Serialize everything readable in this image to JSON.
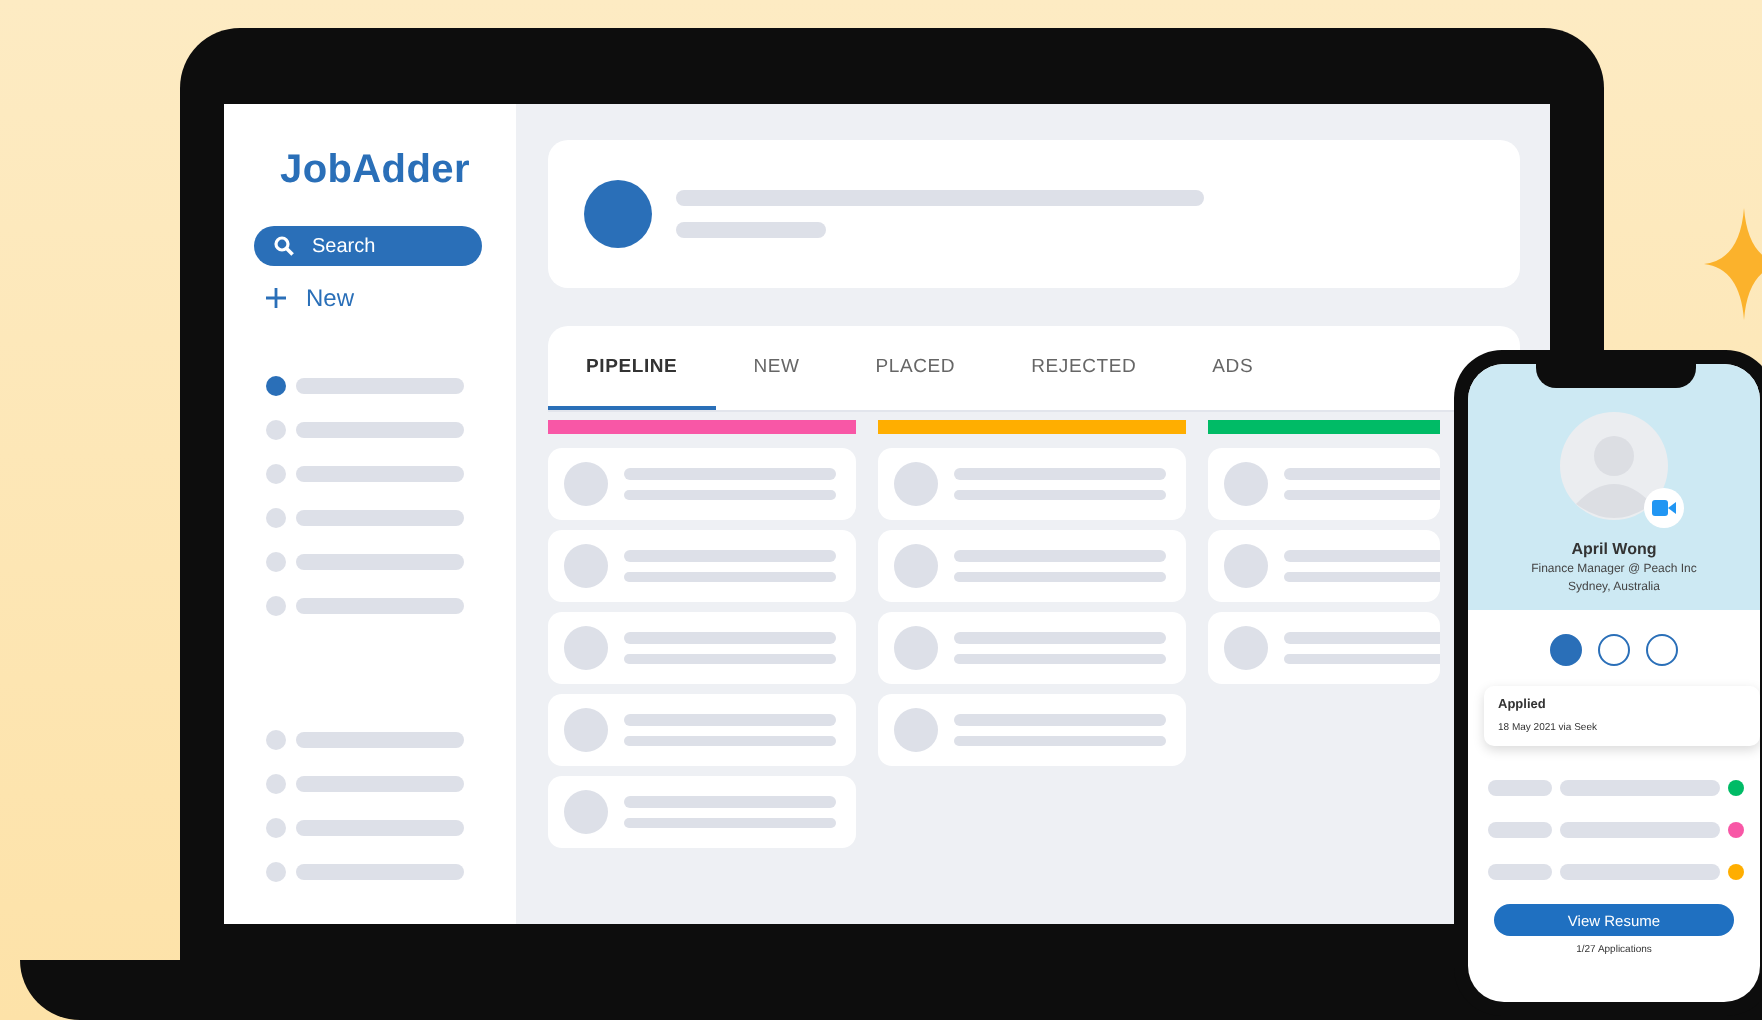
{
  "sidebar": {
    "logo": "JobAdder",
    "search": {
      "placeholder": "Search"
    },
    "new_label": "New",
    "nav_items": [
      {
        "selected": true
      },
      {
        "selected": false
      },
      {
        "selected": false
      },
      {
        "selected": false
      },
      {
        "selected": false
      },
      {
        "selected": false
      }
    ],
    "bottom_items": [
      {
        "selected": false
      },
      {
        "selected": false
      },
      {
        "selected": false
      },
      {
        "selected": false
      }
    ]
  },
  "tabs": [
    {
      "label": "PIPELINE",
      "selected": true
    },
    {
      "label": "NEW",
      "selected": false
    },
    {
      "label": "PLACED",
      "selected": false
    },
    {
      "label": "REJECTED",
      "selected": false
    },
    {
      "label": "ADS",
      "selected": false
    }
  ],
  "columns": [
    {
      "color": "#f857a6",
      "cards": [
        {
          "kind": "candidate"
        },
        {
          "kind": "candidate"
        },
        {
          "kind": "candidate"
        },
        {
          "kind": "candidate"
        },
        {
          "kind": "candidate"
        }
      ]
    },
    {
      "color": "#ffae00",
      "cards": [
        {
          "kind": "candidate"
        },
        {
          "kind": "candidate"
        },
        {
          "kind": "candidate"
        },
        {
          "kind": "candidate"
        }
      ]
    },
    {
      "color": "#00bb66",
      "cards": [
        {
          "kind": "candidate"
        },
        {
          "kind": "candidate"
        },
        {
          "kind": "candidate"
        }
      ]
    }
  ],
  "phone": {
    "name": "April Wong",
    "job_title": "Finance Manager @ Peach Inc",
    "location": "Sydney, Australia",
    "steps": [
      {
        "selected": true
      },
      {
        "selected": false
      },
      {
        "selected": false
      }
    ],
    "status": {
      "title": "Applied",
      "detail": "18 May 2021 via Seek"
    },
    "rows": [
      {
        "color": "#00bb66"
      },
      {
        "color": "#f857a6"
      },
      {
        "color": "#ffae00"
      }
    ],
    "button": "View Resume",
    "footer": "1/27 Applications"
  }
}
